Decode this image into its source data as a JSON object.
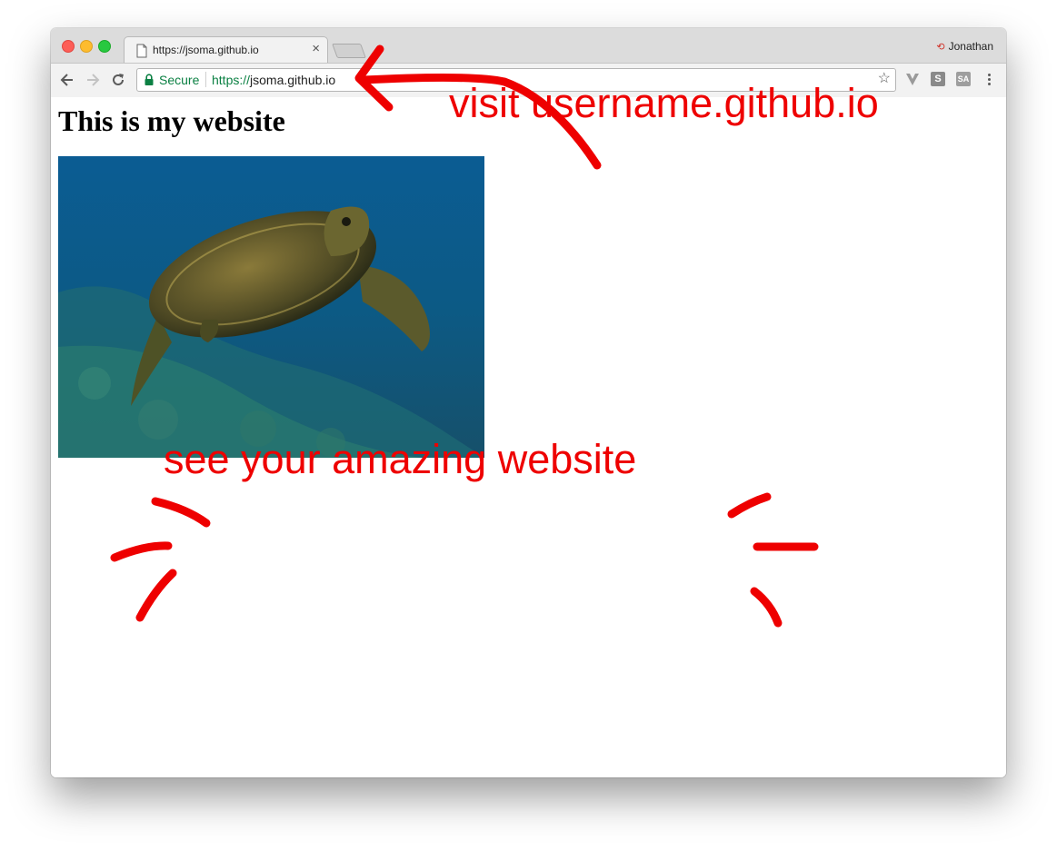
{
  "browser": {
    "tab": {
      "title": "https://jsoma.github.io",
      "close_symbol": "×"
    },
    "profile_name": "Jonathan",
    "address_bar": {
      "secure_label": "Secure",
      "url_scheme": "https://",
      "url_host": "jsoma.github.io"
    },
    "extensions": {
      "s_label": "S",
      "sa_label": "SA"
    }
  },
  "page": {
    "heading": "This is my website",
    "image": "sea turtle swimming over coral reef"
  },
  "annotations": {
    "callout_1": "visit username.github.io",
    "callout_2": "see your amazing website",
    "ink_color": "#ee0000"
  }
}
